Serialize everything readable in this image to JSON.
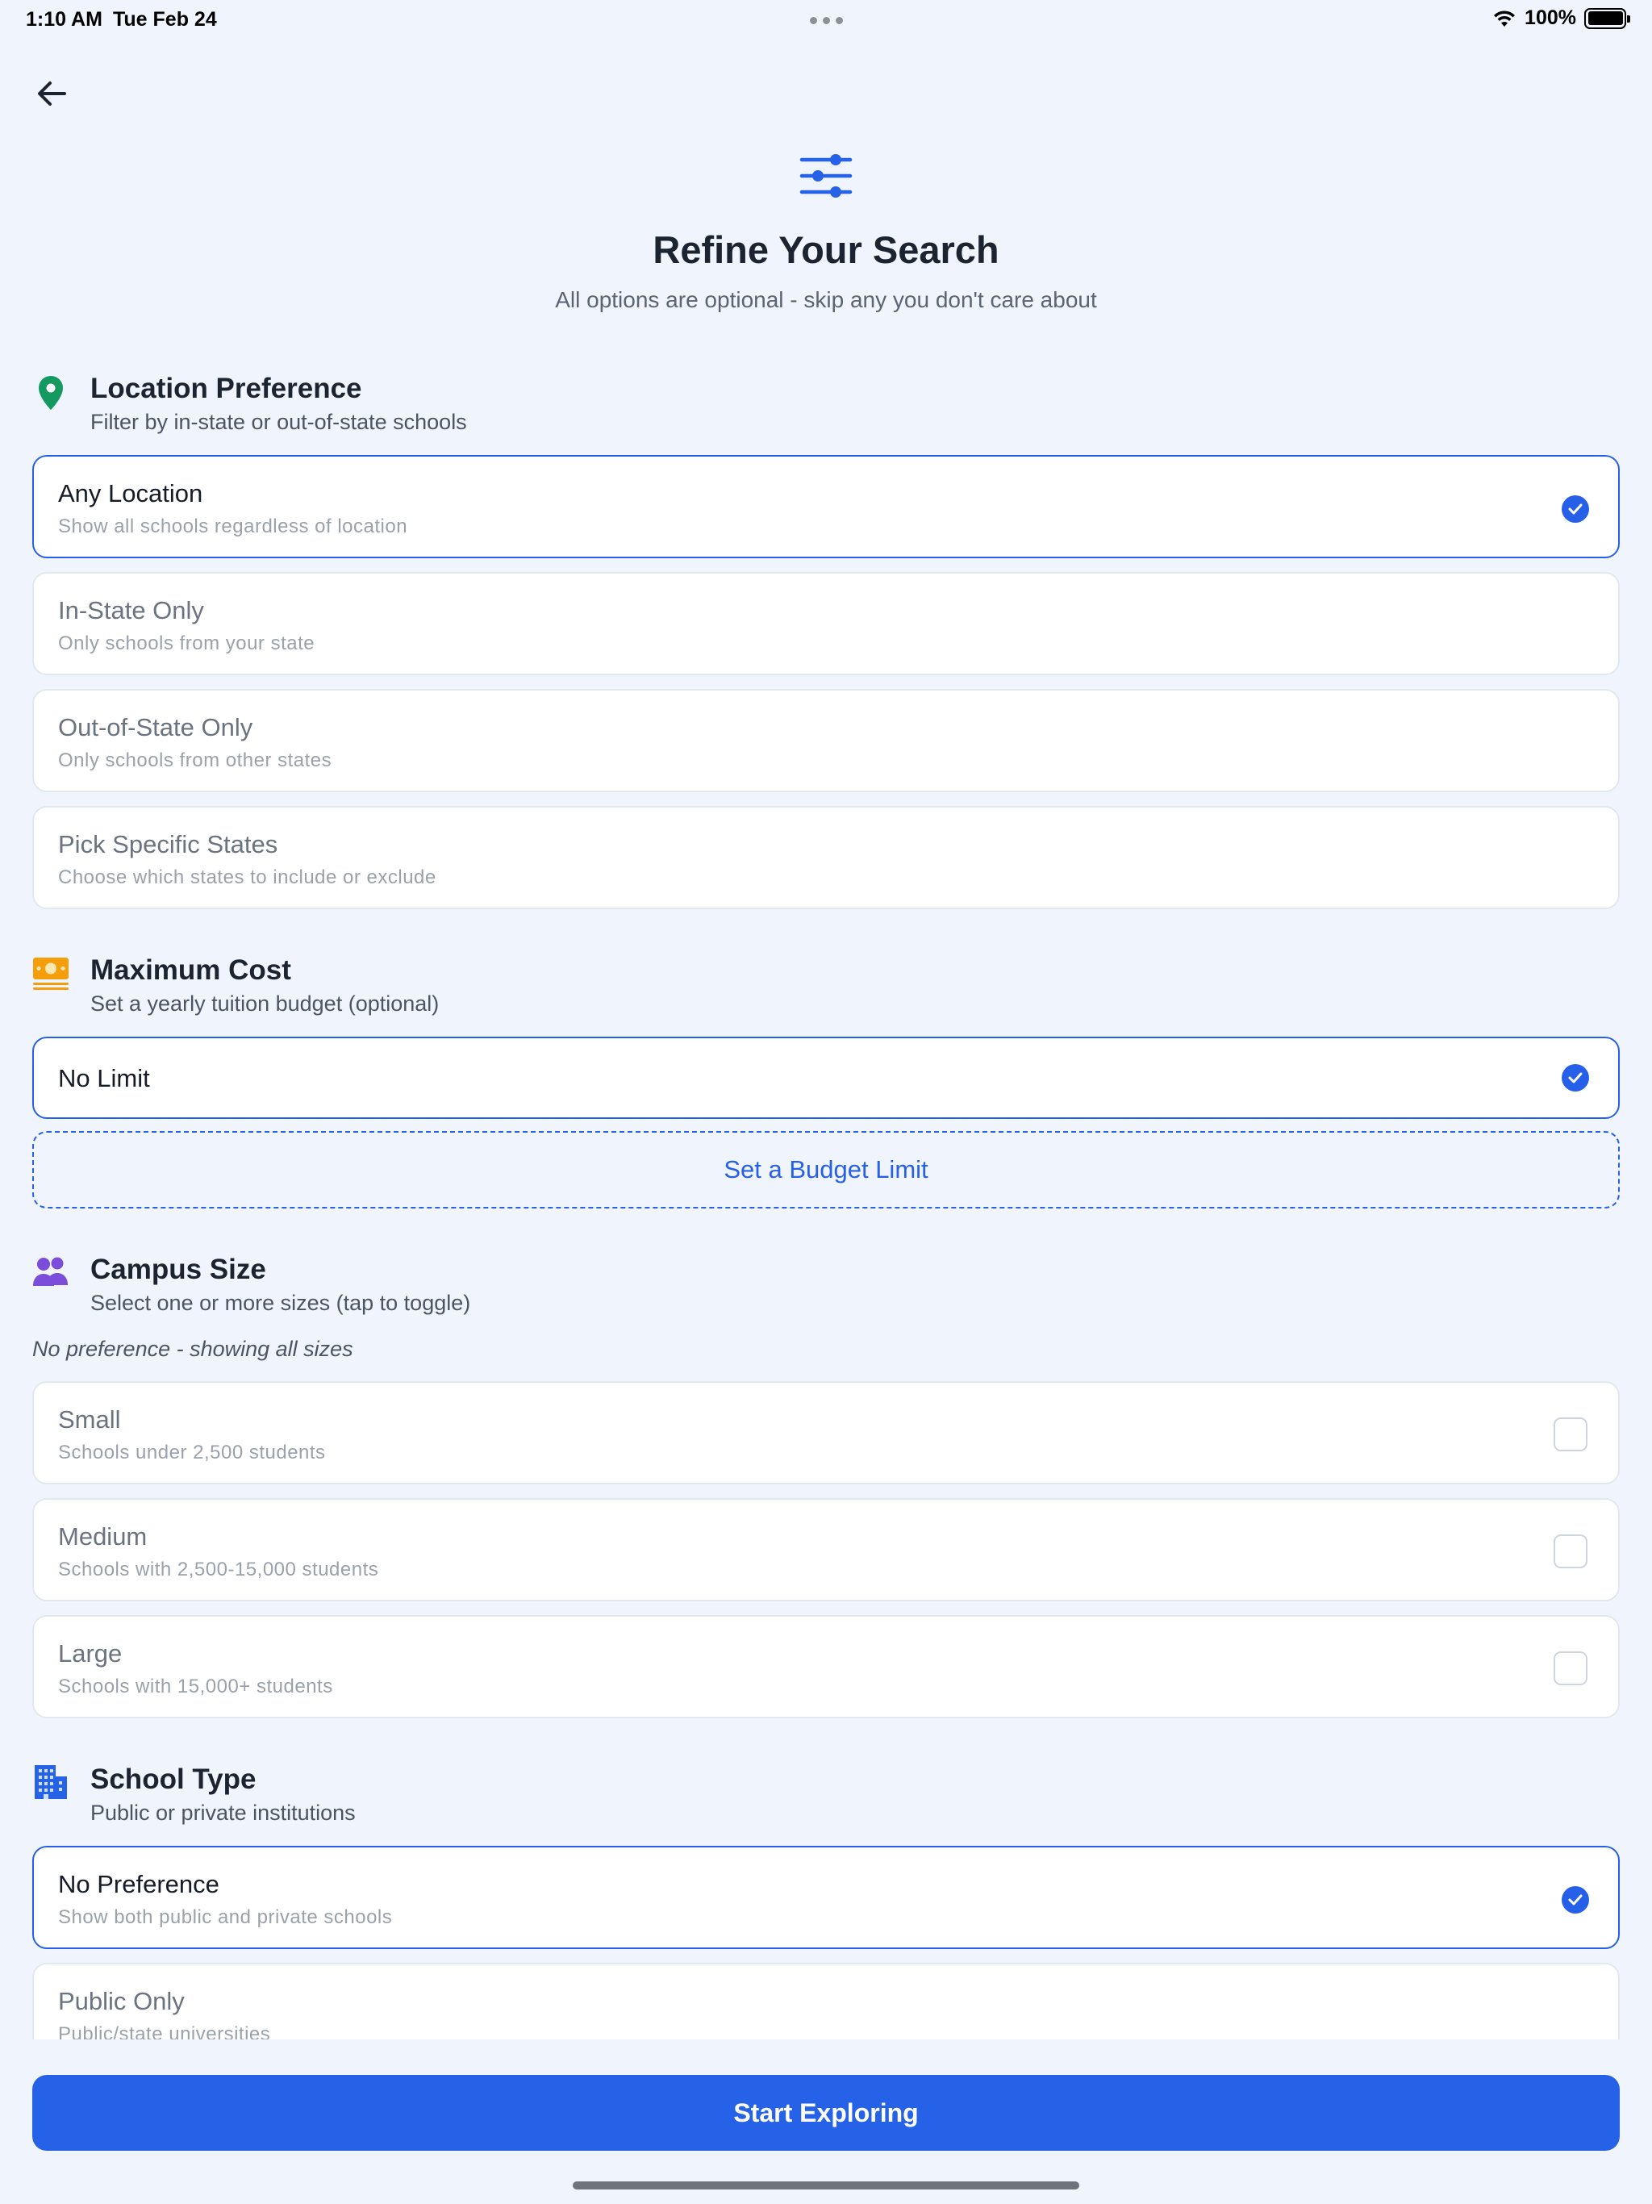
{
  "status": {
    "time": "1:10 AM",
    "date": "Tue Feb 24",
    "battery": "100%"
  },
  "header": {
    "title": "Refine Your Search",
    "subtitle": "All options are optional - skip any you don't care about"
  },
  "location": {
    "title": "Location Preference",
    "subtitle": "Filter by in-state or out-of-state schools",
    "options": [
      {
        "label": "Any Location",
        "desc": "Show all schools regardless of location",
        "selected": true
      },
      {
        "label": "In-State Only",
        "desc": "Only schools from your state",
        "selected": false
      },
      {
        "label": "Out-of-State Only",
        "desc": "Only schools from other states",
        "selected": false
      },
      {
        "label": "Pick Specific States",
        "desc": "Choose which states to include or exclude",
        "selected": false
      }
    ]
  },
  "cost": {
    "title": "Maximum Cost",
    "subtitle": "Set a yearly tuition budget (optional)",
    "no_limit": "No Limit",
    "set_budget": "Set a Budget Limit"
  },
  "campus": {
    "title": "Campus Size",
    "subtitle": "Select one or more sizes (tap to toggle)",
    "note": "No preference - showing all sizes",
    "options": [
      {
        "label": "Small",
        "desc": "Schools under 2,500 students",
        "checked": false
      },
      {
        "label": "Medium",
        "desc": "Schools with 2,500-15,000 students",
        "checked": false
      },
      {
        "label": "Large",
        "desc": "Schools with 15,000+ students",
        "checked": false
      }
    ]
  },
  "school_type": {
    "title": "School Type",
    "subtitle": "Public or private institutions",
    "options": [
      {
        "label": "No Preference",
        "desc": "Show both public and private schools",
        "selected": true
      },
      {
        "label": "Public Only",
        "desc": "Public/state universities",
        "selected": false
      }
    ]
  },
  "cta": {
    "label": "Start Exploring"
  },
  "colors": {
    "accent": "#2662e8",
    "background": "#f0f5fd",
    "location_icon": "#149a61",
    "cost_icon": "#f59e0b",
    "campus_icon": "#7c4ddb",
    "school_icon": "#2662e8"
  },
  "icons": {
    "back": "arrow-left-icon",
    "header": "sliders-icon",
    "location": "map-pin-icon",
    "cost": "money-icon",
    "campus": "people-icon",
    "school": "building-icon"
  }
}
